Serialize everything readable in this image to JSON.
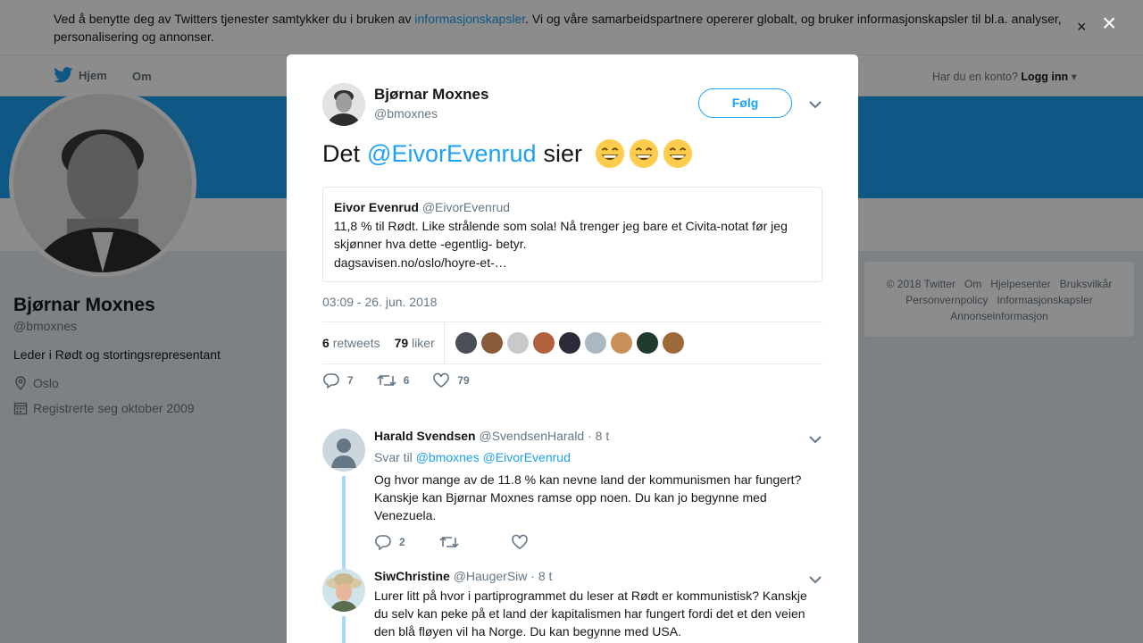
{
  "cookie": {
    "text_before": "Ved å benytte deg av Twitters tjenester samtykker du i bruken av ",
    "link": "informasjonskapsler",
    "text_after": ". Vi og våre samarbeidspartnere opererer globalt, og bruker informasjonskapsler til bl.a. analyser, personalisering og annonser.",
    "close": "×"
  },
  "nav": {
    "home": "Hjem",
    "about": "Om",
    "account_q": "Har du en konto?",
    "login": "Logg inn"
  },
  "profile": {
    "name": "Bjørnar Moxnes",
    "handle": "@bmoxnes",
    "bio": "Leder i Rødt og stortingsrepresentant",
    "location": "Oslo",
    "joined": "Registrerte seg oktober 2009"
  },
  "footer": {
    "links": [
      "© 2018 Twitter",
      "Om",
      "Hjelpesenter",
      "Bruksvilkår",
      "Personvernpolicy",
      "Informasjonskapsler",
      "Annonseinformasjon"
    ]
  },
  "modal_close": "×",
  "tweet": {
    "name": "Bjørnar Moxnes",
    "handle": "@bmoxnes",
    "follow": "Følg",
    "text_before": "Det",
    "mention": "@EivorEvenrud",
    "text_after": "sier",
    "quote": {
      "name": "Eivor Evenrud",
      "handle": "@EivorEvenrud",
      "body": "11,8 % til Rødt. Like strålende som sola!  Nå trenger jeg bare et Civita-notat før jeg skjønner hva dette -egentlig- betyr.",
      "link": "dagsavisen.no/oslo/hoyre-et-…"
    },
    "time": "03:09 - 26. jun. 2018",
    "retweets_count": "6",
    "retweets_label": "retweets",
    "likes_count": "79",
    "likes_label": "liker",
    "likers_colors": [
      "#4a4f55",
      "#8a5a3c",
      "#c9c9c9",
      "#b0603a",
      "#2b2b3a",
      "#aab8c2",
      "#c98f5a",
      "#1e3b2c",
      "#9a6a3a"
    ],
    "actions": {
      "replies": "7",
      "retweets": "6",
      "likes": "79"
    }
  },
  "replies": [
    {
      "name": "Harald Svendsen",
      "handle": "@SvendsenHarald",
      "time": "· 8 t",
      "reply_to_label": "Svar til",
      "reply_to": "@bmoxnes @EivorEvenrud",
      "body": "Og hvor mange av de 11.8 % kan nevne land der kommunismen har fungert? Kanskje kan Bjørnar Moxnes ramse opp noen. Du kan jo begynne med Venezuela.",
      "replies": "2"
    },
    {
      "name": "SiwChristine",
      "handle": "@HaugerSiw",
      "time": "· 8 t",
      "body": "Lurer litt på hvor i partiprogrammet du leser at Rødt er kommunistisk? Kanskje du selv kan peke på et land der kapitalismen har fungert fordi det et den veien den blå fløyen vil ha Norge. Du kan begynne med USA."
    }
  ]
}
